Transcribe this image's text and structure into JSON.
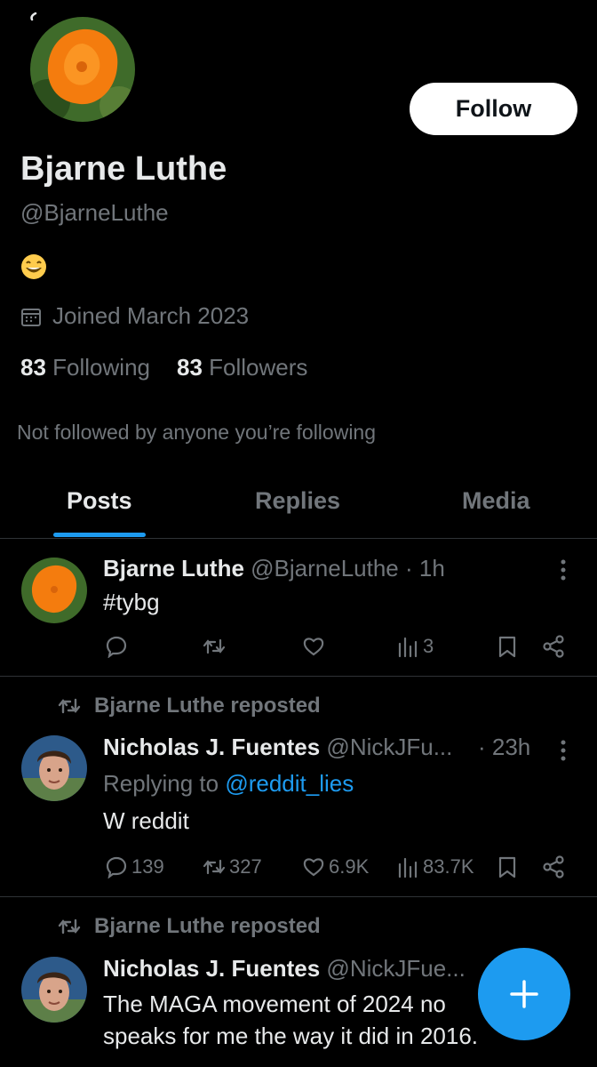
{
  "profile": {
    "name": "Bjarne Luthe",
    "handle": "@BjarneLuthe",
    "bio_emoji": "😁",
    "joined": "Joined March 2023",
    "following_count": "83",
    "following_label": "Following",
    "followers_count": "83",
    "followers_label": "Followers",
    "not_followed": "Not followed by anyone you’re following",
    "follow_label": "Follow"
  },
  "tabs": [
    {
      "label": "Posts",
      "active": true
    },
    {
      "label": "Replies",
      "active": false
    },
    {
      "label": "Media",
      "active": false
    }
  ],
  "posts": [
    {
      "author": "Bjarne Luthe",
      "handle": "@BjarneLuthe",
      "time": "· 1h",
      "text": "#tybg",
      "views": "3"
    },
    {
      "repost_label": "Bjarne Luthe reposted",
      "author": "Nicholas J. Fuentes",
      "handle": "@NickJFu...",
      "time": "· 23h",
      "reply_prefix": "Replying to",
      "reply_to": "@reddit_lies",
      "text": "W reddit",
      "replies": "139",
      "reposts": "327",
      "likes": "6.9K",
      "views": "83.7K"
    },
    {
      "repost_label": "Bjarne Luthe reposted",
      "author": "Nicholas J. Fuentes",
      "handle": "@NickJFue...",
      "text_line1": "The MAGA movement of 2024 no",
      "text_line2": "speaks for me the way it did in 2016."
    }
  ],
  "colors": {
    "accent": "#1d9bf0",
    "muted": "#71767b",
    "text": "#e7e9ea",
    "bg": "#000000"
  },
  "icons": [
    "back-icon",
    "calendar-icon",
    "reply-icon",
    "repost-icon",
    "like-icon",
    "views-icon",
    "bookmark-icon",
    "share-icon",
    "more-icon",
    "compose-icon"
  ]
}
